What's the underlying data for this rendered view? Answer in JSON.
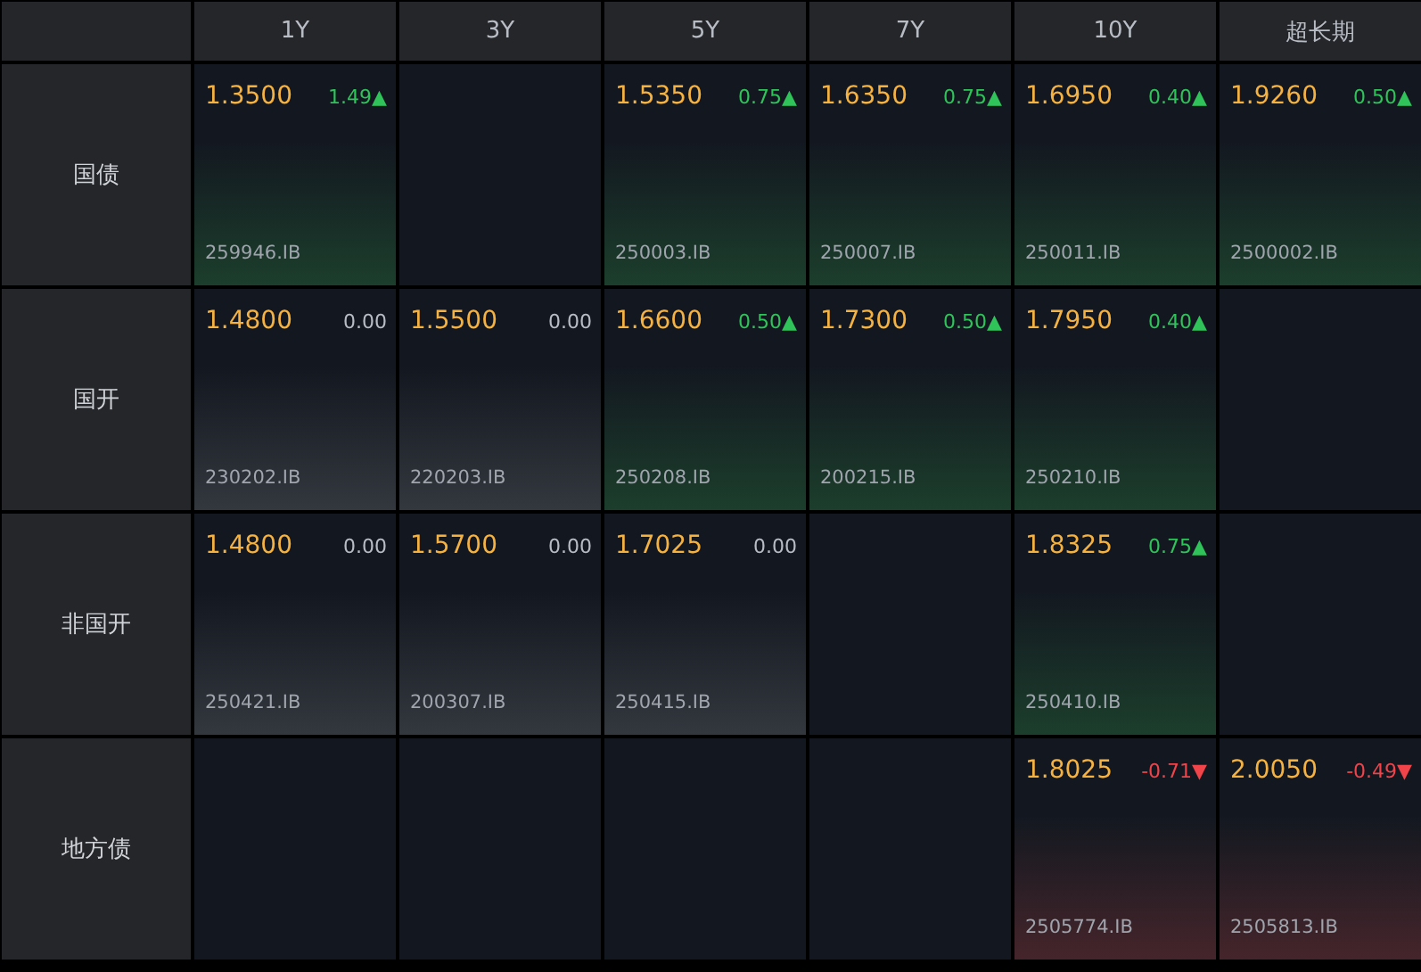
{
  "columns": [
    "1Y",
    "3Y",
    "5Y",
    "7Y",
    "10Y",
    "超长期"
  ],
  "rows": [
    {
      "label": "国债",
      "cells": [
        {
          "kind": "up",
          "price": "1.3500",
          "change": "1.49",
          "arrow": "▲",
          "code": "259946.IB"
        },
        {
          "kind": "empty"
        },
        {
          "kind": "up",
          "price": "1.5350",
          "change": "0.75",
          "arrow": "▲",
          "code": "250003.IB"
        },
        {
          "kind": "up",
          "price": "1.6350",
          "change": "0.75",
          "arrow": "▲",
          "code": "250007.IB"
        },
        {
          "kind": "up",
          "price": "1.6950",
          "change": "0.40",
          "arrow": "▲",
          "code": "250011.IB"
        },
        {
          "kind": "up",
          "price": "1.9260",
          "change": "0.50",
          "arrow": "▲",
          "code": "2500002.IB"
        }
      ]
    },
    {
      "label": "国开",
      "cells": [
        {
          "kind": "flat",
          "price": "1.4800",
          "change": "0.00",
          "code": "230202.IB"
        },
        {
          "kind": "flat",
          "price": "1.5500",
          "change": "0.00",
          "code": "220203.IB"
        },
        {
          "kind": "up",
          "price": "1.6600",
          "change": "0.50",
          "arrow": "▲",
          "code": "250208.IB"
        },
        {
          "kind": "up",
          "price": "1.7300",
          "change": "0.50",
          "arrow": "▲",
          "code": "200215.IB"
        },
        {
          "kind": "up",
          "price": "1.7950",
          "change": "0.40",
          "arrow": "▲",
          "code": "250210.IB"
        },
        {
          "kind": "empty"
        }
      ]
    },
    {
      "label": "非国开",
      "cells": [
        {
          "kind": "flat",
          "price": "1.4800",
          "change": "0.00",
          "code": "250421.IB"
        },
        {
          "kind": "flat",
          "price": "1.5700",
          "change": "0.00",
          "code": "200307.IB"
        },
        {
          "kind": "flat",
          "price": "1.7025",
          "change": "0.00",
          "code": "250415.IB"
        },
        {
          "kind": "empty"
        },
        {
          "kind": "up",
          "price": "1.8325",
          "change": "0.75",
          "arrow": "▲",
          "code": "250410.IB"
        },
        {
          "kind": "empty"
        }
      ]
    },
    {
      "label": "地方债",
      "cells": [
        {
          "kind": "empty"
        },
        {
          "kind": "empty"
        },
        {
          "kind": "empty"
        },
        {
          "kind": "empty"
        },
        {
          "kind": "down",
          "price": "1.8025",
          "change": "-0.71",
          "arrow": "▼",
          "code": "2505774.IB"
        },
        {
          "kind": "down",
          "price": "2.0050",
          "change": "-0.49",
          "arrow": "▼",
          "code": "2505813.IB"
        }
      ]
    }
  ]
}
